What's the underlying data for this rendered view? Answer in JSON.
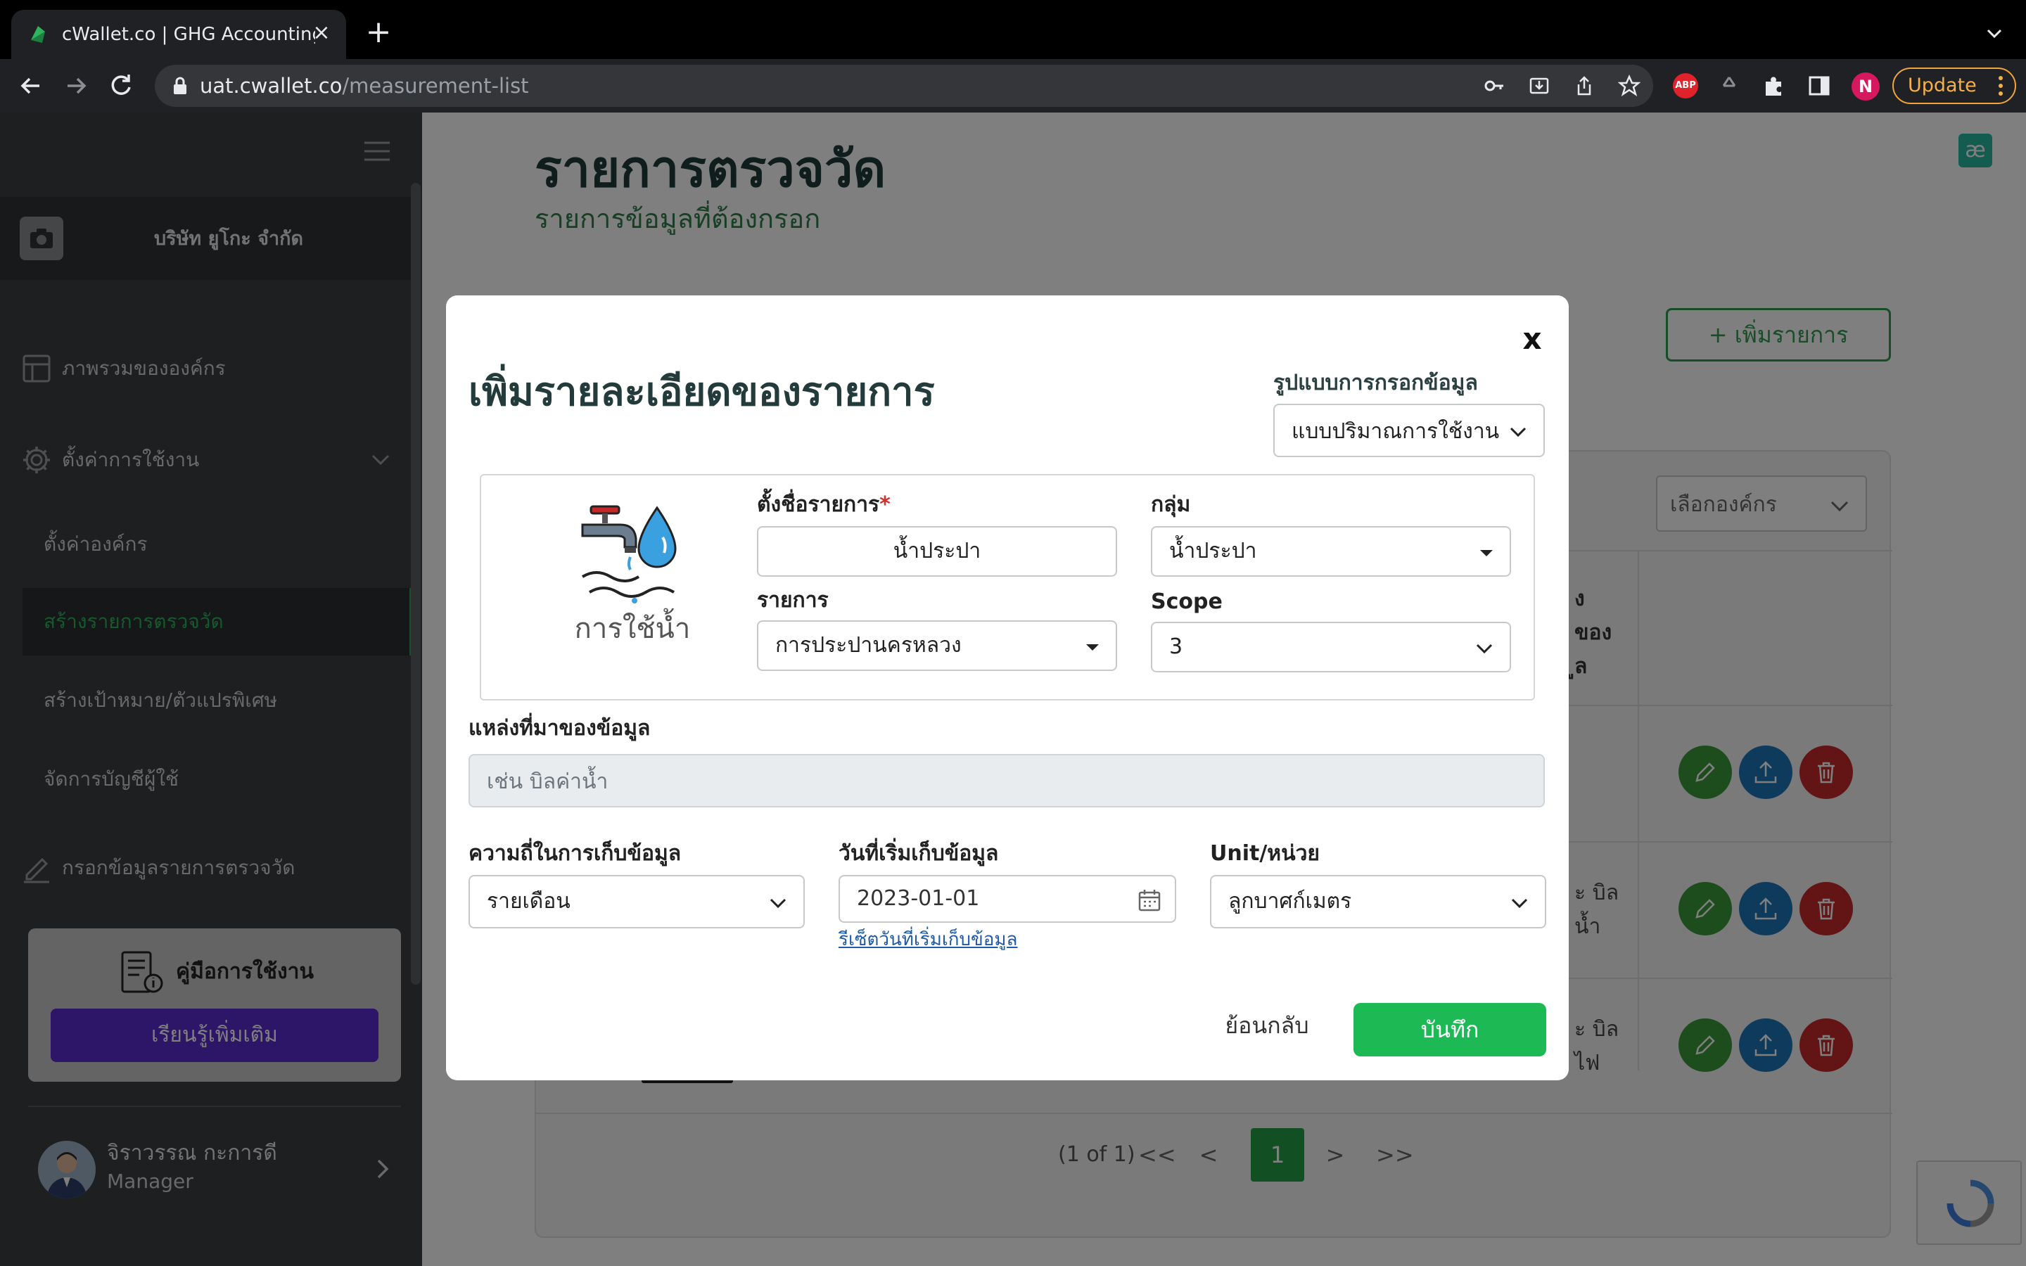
{
  "browser": {
    "tab_title": "cWallet.co | GHG Accounting S",
    "url_domain": "uat.cwallet.co",
    "url_path": "/measurement-list",
    "profile_initial": "N",
    "update_label": "Update",
    "abp_label": "ABP"
  },
  "sidebar": {
    "org_name": "บริษัท ยูโกะ จำกัด",
    "items": [
      {
        "label": "ภาพรวมขององค์กร",
        "icon": "layout-icon"
      },
      {
        "label": "ตั้งค่าการใช้งาน",
        "icon": "gear-icon"
      }
    ],
    "sub_items": [
      {
        "label": "ตั้งค่าองค์กร"
      },
      {
        "label": "สร้างรายการตรวจวัด",
        "active": true
      },
      {
        "label": "สร้างเป้าหมาย/ตัวแปรพิเศษ"
      },
      {
        "label": "จัดการบัญชีผู้ใช้"
      }
    ],
    "fill_item": {
      "label": "กรอกข้อมูลรายการตรวจวัด",
      "icon": "pencil-icon"
    },
    "manual": {
      "title": "คู่มือการใช้งาน",
      "button": "เรียนรู้เพิ่มเติม"
    },
    "user": {
      "name": "จิราวรรณ กะการดี",
      "role": "Manager"
    }
  },
  "main": {
    "title": "รายการตรวจวัด",
    "subtitle": "รายการข้อมูลที่ต้องกรอก",
    "add_button": "+ เพิ่มรายการ",
    "org_select": "เลือกองค์กร",
    "header_fragment": [
      "ง",
      "ของ",
      "ูล"
    ],
    "row_fragments": [
      {
        "lines": [
          "ะ บิล",
          "น้ำ"
        ]
      },
      {
        "lines": [
          "ะ บิล",
          "ไฟ"
        ]
      }
    ],
    "pagination": {
      "summary": "(1 of 1)",
      "first": "<<",
      "prev": "<",
      "current": "1",
      "next": ">",
      "last": ">>"
    }
  },
  "modal": {
    "close_label": "x",
    "title": "เพิ่มรายละเอียดของรายการ",
    "format_label": "รูปแบบการกรอกข้อมูล",
    "format_value": "แบบปริมาณการใช้งาน",
    "item_icon_label": "การใช้น้ำ",
    "name_label": "ตั้งชื่อรายการ",
    "name_required": "*",
    "name_value": "น้ำประปา",
    "group_label": "กลุ่ม",
    "group_value": "น้ำประปา",
    "item_label": "รายการ",
    "item_value": "การประปานครหลวง",
    "scope_label": "Scope",
    "scope_value": "3",
    "source_label": "แหล่งที่มาของข้อมูล",
    "source_placeholder": "เช่น บิลค่าน้ำ",
    "frequency_label": "ความถี่ในการเก็บข้อมูล",
    "frequency_value": "รายเดือน",
    "start_date_label": "วันที่เริ่มเก็บข้อมูล",
    "start_date_value": "2023-01-01",
    "reset_link": "รีเซ็ตวันที่เริ่มเก็บข้อมูล",
    "unit_label": "Unit/หน่วย",
    "unit_value": "ลูกบาศก์เมตร",
    "back_button": "ย้อนกลับ",
    "save_button": "บันทึก"
  },
  "colors": {
    "sidebar_bg": "#3b3f43",
    "active_green": "#2fb35d",
    "save_green": "#1db954",
    "learn_purple": "#5a2bd1",
    "title_dark": "#243b3b"
  }
}
